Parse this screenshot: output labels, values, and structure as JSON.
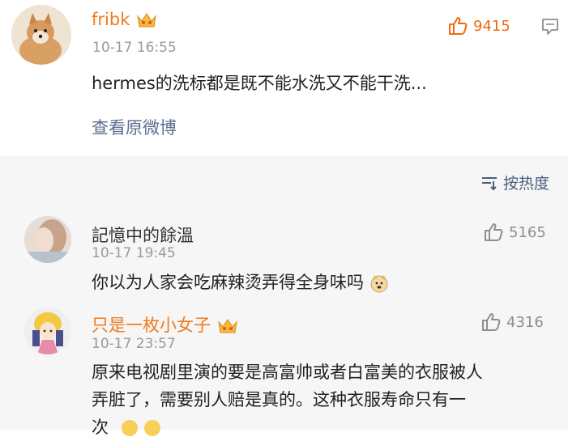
{
  "main_post": {
    "username": "fribk",
    "time": "10-17 16:55",
    "likes": "9415",
    "content": "hermes的洗标都是既不能水洗又不能干洗...",
    "view_original": "查看原微博"
  },
  "sort_label": "按热度",
  "comments": [
    {
      "username": "記憶中的餘溫",
      "time": "10-17 19:45",
      "likes": "5165",
      "text": "你以为人家会吃麻辣烫弄得全身味吗"
    },
    {
      "username": "只是一枚小女子",
      "time": "10-17 23:57",
      "likes": "4316",
      "text_line1": "原来电视剧里演的要是高富帅或者白富美的衣服被人",
      "text_line2": "弄脏了，需要别人赔是真的。这种衣服寿命只有一",
      "text_line3": "次"
    }
  ],
  "colors": {
    "orange": "#ef7a1e",
    "link_blue": "#5a6f8f",
    "gray_bg": "#f6f6f6"
  }
}
